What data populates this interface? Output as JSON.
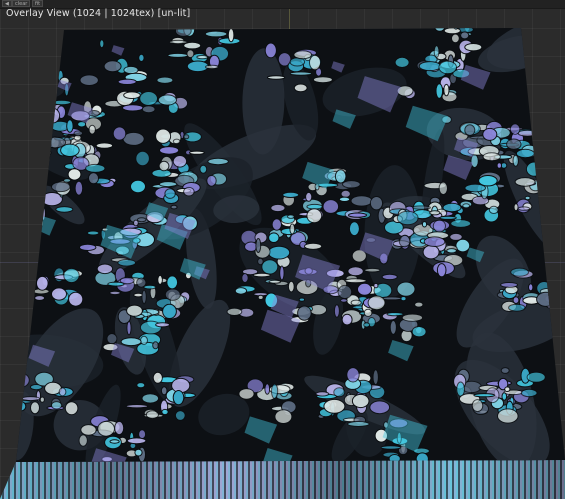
{
  "viewport": {
    "title": "Overlay View (1024 | 1024tex)  [un-lit]",
    "toolbar_buttons": [
      "◀",
      "clear",
      "fit"
    ],
    "texture_description": "acrylic-pour-cells",
    "colors": {
      "base": "#0d1014",
      "cyan": "#43c7e0",
      "violet": "#8a84d8",
      "pale": "#c9d6d6",
      "grid": "#2b2b2b"
    }
  }
}
